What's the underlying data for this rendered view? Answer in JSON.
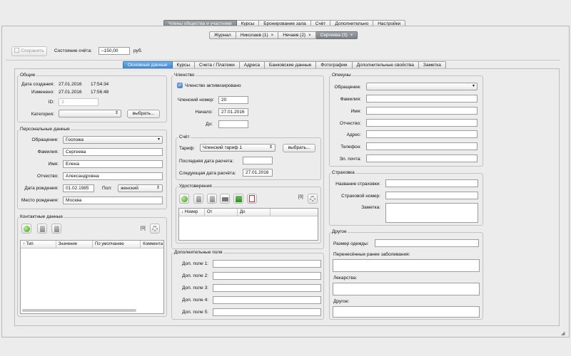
{
  "top_tabs": [
    "Члены общества и участники",
    "Курсы",
    "Бронирование зала",
    "Счёт",
    "Дополнительно",
    "Настройки"
  ],
  "doc_tabs": [
    {
      "label": "Журнал",
      "closable": false
    },
    {
      "label": "Николаев (1)",
      "closable": true
    },
    {
      "label": "Нечаев (2)",
      "closable": true
    },
    {
      "label": "Сергеева (3)",
      "closable": true
    }
  ],
  "close_glyph": "×",
  "toolbar": {
    "save_label": "Сохранить",
    "balance_label": "Состояние счёта:",
    "balance_value": "–150,00",
    "currency": "руб."
  },
  "sub_tabs": [
    "Основные данные",
    "Курсы",
    "Счета / Платежи",
    "Адреса",
    "Банковские данные",
    "Фотографии",
    "Дополнительные свойства",
    "Заметка"
  ],
  "general": {
    "title": "Общие",
    "created_label": "Дата создания:",
    "created_date": "27.01.2016",
    "created_time": "17:54:34",
    "modified_label": "Изменено:",
    "modified_date": "27.01.2016",
    "modified_time": "17:56:48",
    "id_label": "ID:",
    "id_value": "3",
    "category_label": "Категория:",
    "category_value": "",
    "choose_label": "выбрать..."
  },
  "personal": {
    "title": "Персональные данные",
    "salutation_label": "Обращение:",
    "salutation_value": "Госпожа",
    "surname_label": "Фамилия:",
    "surname_value": "Сергеева",
    "name_label": "Имя:",
    "name_value": "Елена",
    "patronymic_label": "Отчество:",
    "patronymic_value": "Александровна",
    "birthdate_label": "Дата рождения:",
    "birthdate_value": "01.02.1985",
    "gender_label": "Пол:",
    "gender_value": "женский",
    "birthplace_label": "Место рождения:",
    "birthplace_value": "Москва"
  },
  "contacts": {
    "title": "Контактные данные",
    "count": "[0]",
    "columns": [
      "↑ Тип",
      "Значение",
      "По умолчанию",
      "Коммента"
    ]
  },
  "membership": {
    "title": "Членство",
    "active_label": "Членство активизировано",
    "number_label": "Членский номер:",
    "number_value": "20",
    "start_label": "Начало:",
    "start_value": "27.01.2016",
    "end_label": "До:",
    "end_value": ""
  },
  "account": {
    "title": "Счёт",
    "tariff_label": "Тариф:",
    "tariff_value": "Членский тариф 1",
    "choose_label": "выбрать...",
    "last_billing_label": "Последняя дата расчета:",
    "last_billing_value": "",
    "next_billing_label": "Следующая дата расчёта:",
    "next_billing_value": "27.01.2016"
  },
  "certificates": {
    "title": "Удостоверения",
    "count": "[0]",
    "columns": [
      "↓ Номер",
      "От",
      "До"
    ]
  },
  "extra_fields": {
    "title": "Дополнительные поля",
    "fields": [
      "Доп. поле 1:",
      "Доп. поле 2:",
      "Доп. поле 3:",
      "Доп. поле 4:",
      "Доп. поле 5:"
    ]
  },
  "guardians": {
    "title": "Опекуны",
    "salutation_label": "Обращение:",
    "surname_label": "Фамилия:",
    "name_label": "Имя:",
    "patronymic_label": "Отчество:",
    "address_label": "Адрес:",
    "phone_label": "Телефон:",
    "email_label": "Эл. почта:"
  },
  "insurance": {
    "title": "Страховка",
    "company_label": "Название страховки:",
    "number_label": "Страховой номер:",
    "note_label": "Заметка:"
  },
  "other": {
    "title": "Другое",
    "clothing_label": "Размер одежды:",
    "illness_label": "Перенесённые ранее заболевания:",
    "medicine_label": "Лекарства:",
    "other_label": "Другое:"
  },
  "glyphs": {
    "dropdown": "▾",
    "stepper": "⇕",
    "checkmark": "✓"
  },
  "icons": [
    "add-icon",
    "edit-icon",
    "delete-icon",
    "settings-icon",
    "print-icon",
    "export-icon",
    "pdf-icon"
  ],
  "colors": {
    "selected_tab": "#8a8f95",
    "active_subtab": "#4a90d9"
  }
}
